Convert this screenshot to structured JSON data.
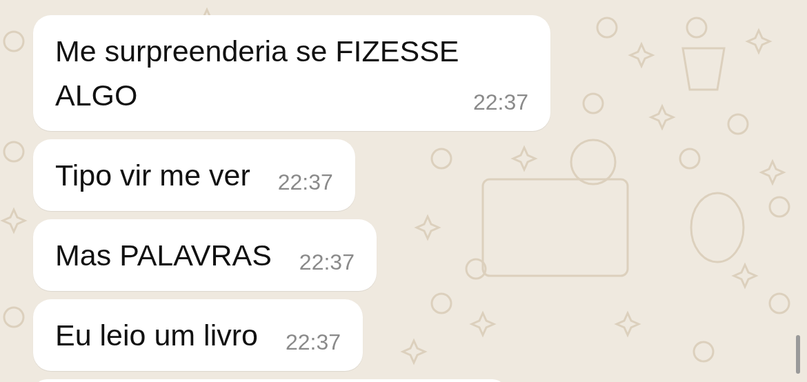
{
  "messages": [
    {
      "text": "Me surpreenderia se FIZESSE ALGO",
      "time": "22:37"
    },
    {
      "text": "Tipo vir me ver",
      "time": "22:37"
    },
    {
      "text": "Mas PALAVRAS",
      "time": "22:37"
    },
    {
      "text": "Eu leio um livro",
      "time": "22:37"
    }
  ]
}
